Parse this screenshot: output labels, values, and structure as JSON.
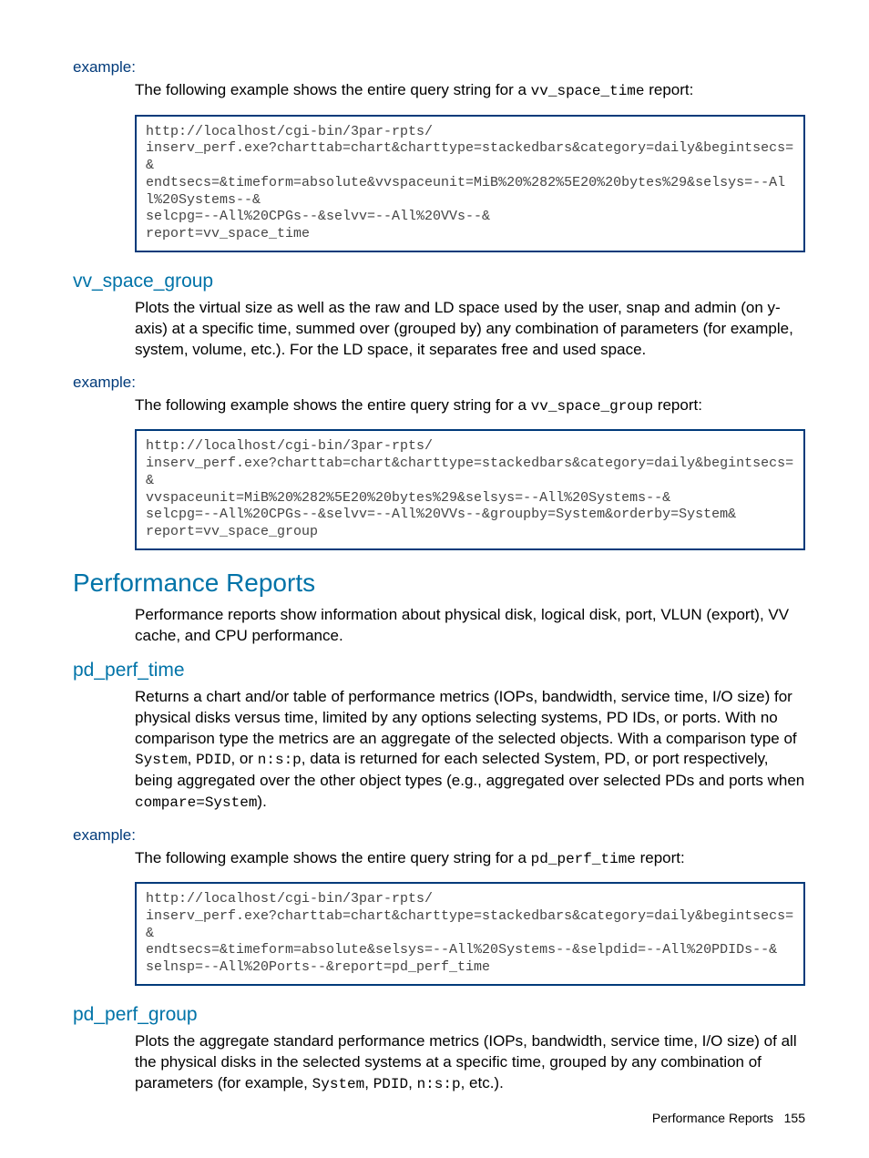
{
  "sections": {
    "example1": {
      "label": "example:",
      "intro_pre": "The following example shows the entire query string for a ",
      "intro_mono": "vv_space_time",
      "intro_post": " report:",
      "code": "http://localhost/cgi-bin/3par-rpts/\ninserv_perf.exe?charttab=chart&charttype=stackedbars&category=daily&begintsecs=&\nendtsecs=&timeform=absolute&vvspaceunit=MiB%20%282%5E20%20bytes%29&selsys=--All%20Systems--&\nselcpg=--All%20CPGs--&selvv=--All%20VVs--&\nreport=vv_space_time"
    },
    "vv_space_group": {
      "title": "vv_space_group",
      "para": "Plots the virtual size as well as the raw and LD space used by the user, snap and admin (on y-axis) at a specific time, summed over (grouped by) any combination of parameters (for example, system, volume, etc.). For the LD space, it separates free and used space."
    },
    "example2": {
      "label": "example:",
      "intro_pre": "The following example shows the entire query string for a ",
      "intro_mono": "vv_space_group",
      "intro_post": " report:",
      "code": "http://localhost/cgi-bin/3par-rpts/\ninserv_perf.exe?charttab=chart&charttype=stackedbars&category=daily&begintsecs=&\nvvspaceunit=MiB%20%282%5E20%20bytes%29&selsys=--All%20Systems--&\nselcpg=--All%20CPGs--&selvv=--All%20VVs--&groupby=System&orderby=System&\nreport=vv_space_group"
    },
    "perf_reports": {
      "title": "Performance Reports",
      "para": "Performance reports show information about physical disk, logical disk, port, VLUN (export), VV cache, and CPU performance."
    },
    "pd_perf_time": {
      "title": "pd_perf_time",
      "para_pre": "Returns a chart and/or table of performance metrics (IOPs, bandwidth, service time, I/O size) for physical disks versus time, limited by any options selecting systems, PD IDs, or ports. With no comparison type the metrics are an aggregate of the selected objects. With a comparison type of ",
      "mono1": "System",
      "m1_post": ", ",
      "mono2": "PDID",
      "m2_post": ", or ",
      "mono3": "n:s:p",
      "m3_post": ", data is returned for each selected System, PD, or port respectively, being aggregated over the other object types (e.g., aggregated over selected PDs and ports when ",
      "mono4": "compare=System",
      "m4_post": ")."
    },
    "example3": {
      "label": "example:",
      "intro_pre": "The following example shows the entire query string for a ",
      "intro_mono": "pd_perf_time",
      "intro_post": " report:",
      "code": "http://localhost/cgi-bin/3par-rpts/\ninserv_perf.exe?charttab=chart&charttype=stackedbars&category=daily&begintsecs=&\nendtsecs=&timeform=absolute&selsys=--All%20Systems--&selpdid=--All%20PDIDs--&\nselnsp=--All%20Ports--&report=pd_perf_time"
    },
    "pd_perf_group": {
      "title": "pd_perf_group",
      "para_pre": "Plots the aggregate standard performance metrics (IOPs, bandwidth, service time, I/O size) of all the physical disks in the selected systems at a specific time, grouped by any combination of parameters (for example, ",
      "mono1": "System",
      "m1_post": ", ",
      "mono2": "PDID",
      "m2_post": ", ",
      "mono3": "n:s:p",
      "m3_post": ", etc.)."
    }
  },
  "footer": {
    "label": "Performance Reports",
    "page": "155"
  }
}
